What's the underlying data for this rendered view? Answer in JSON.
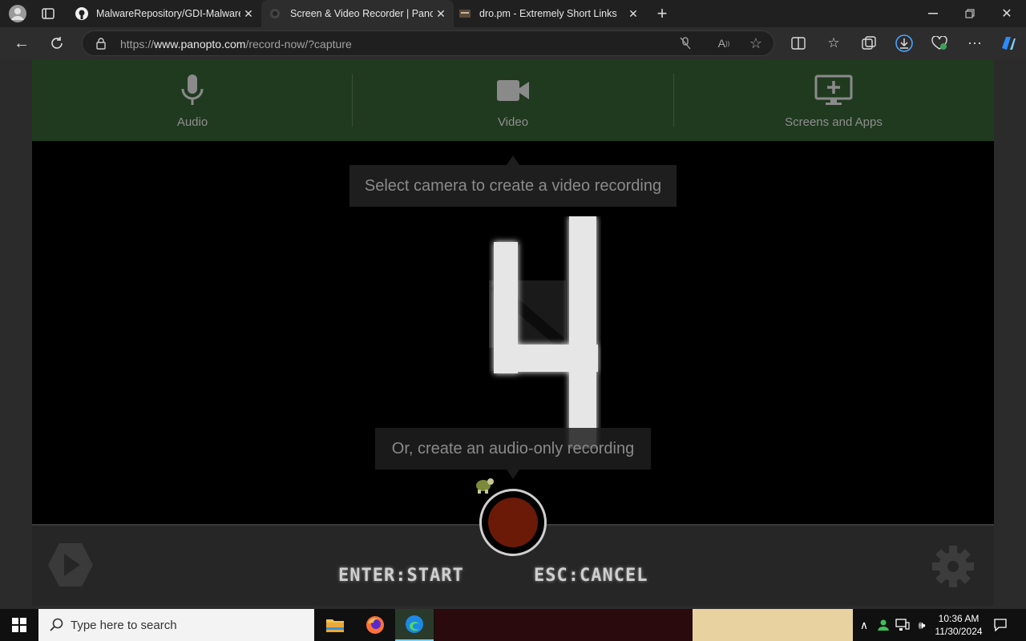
{
  "browser": {
    "tabs": [
      {
        "title": "MalwareRepository/GDI-Malware",
        "icon": "github-icon"
      },
      {
        "title": "Screen & Video Recorder | Panop",
        "icon": "panopto-icon"
      },
      {
        "title": "dro.pm - Extremely Short Links",
        "icon": "dropm-icon"
      }
    ],
    "url_prefix": "https://",
    "url_host": "www.panopto.com",
    "url_path": "/record-now/?capture"
  },
  "recorder": {
    "sources": [
      {
        "label": "Audio",
        "icon": "microphone-icon"
      },
      {
        "label": "Video",
        "icon": "video-camera-icon"
      },
      {
        "label": "Screens and Apps",
        "icon": "monitor-plus-icon"
      }
    ],
    "video_hint": "Select camera to create a video recording",
    "audio_hint": "Or, create an audio-only recording",
    "countdown": "4",
    "enter_hint": "ENTER:START",
    "esc_hint": "ESC:CANCEL"
  },
  "taskbar": {
    "search_placeholder": "Type here to search",
    "time": "10:36 AM",
    "date": "11/30/2024"
  },
  "colors": {
    "sources_bg": "#203a1f",
    "record_button": "#6b1a08"
  }
}
